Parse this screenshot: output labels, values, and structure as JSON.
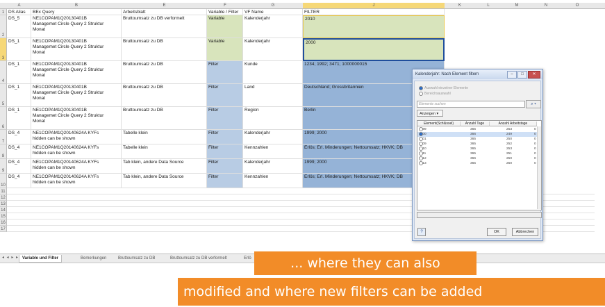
{
  "columns": [
    "A",
    "B",
    "E",
    "F",
    "G",
    "J",
    "K",
    "L",
    "M",
    "N",
    "O"
  ],
  "header_row": {
    "row_number": "1",
    "ds_alias": "DS Alias",
    "bex_query": "BEx Query",
    "arbeitsblatt": "Arbeitsblatt",
    "variable_filter": "Variable / Filter",
    "vf_name": "VF Name",
    "filter": "FILTER"
  },
  "rows": [
    {
      "num": "2",
      "ds": "DS_5",
      "query": "NE1COPAM1Q20130401B\nManagemet Circle Query 2 Struktur\nMonat",
      "sheet": "Bruttoumsatz zu DB verformelt",
      "type": "Variable",
      "name": "Kalenderjahr",
      "filter": "2010"
    },
    {
      "num": "3",
      "ds": "DS_1",
      "query": "NE1COPAM1Q20130401B\nManagemet Circle Query 2 Struktur\nMonat",
      "sheet": "Bruttoumsatz zu DB",
      "type": "Variable",
      "name": "Kalenderjahr",
      "filter": "2000"
    },
    {
      "num": "4",
      "ds": "DS_1",
      "query": "NE1COPAM1Q20130401B\nManagemet Circle Query 2 Struktur\nMonat",
      "sheet": "Bruttoumsatz zu DB",
      "type": "Filter",
      "name": "Kunde",
      "filter": "1234; 1992; 3471; 1000000015"
    },
    {
      "num": "5",
      "ds": "DS_1",
      "query": "NE1COPAM1Q20130401B\nManagemet Circle Query 2 Struktur\nMonat",
      "sheet": "Bruttoumsatz zu DB",
      "type": "Filter",
      "name": "Land",
      "filter": "Deutschland; Grossbritannien"
    },
    {
      "num": "6",
      "ds": "DS_1",
      "query": "NE1COPAM1Q20130401B\nManagemet Circle Query 2 Struktur\nMonat",
      "sheet": "Bruttoumsatz zu DB",
      "type": "Filter",
      "name": "Region",
      "filter": "Berlin"
    },
    {
      "num": "7",
      "ds": "DS_4",
      "query": "NE1COPAM1Q20140624A KYFs\nhidden can be shown",
      "sheet": "Tabelle klein",
      "type": "Filter",
      "name": "Kalenderjahr",
      "filter": "1999; 2000"
    },
    {
      "num": "8",
      "ds": "DS_4",
      "query": "NE1COPAM1Q20140624A KYFs\nhidden can be shown",
      "sheet": "Tabelle klein",
      "type": "Filter",
      "name": "Kennzahlen",
      "filter": "Erlös; Erl. Minderungen; Nettoumsatz; HKVK; DB"
    },
    {
      "num": "9",
      "ds": "DS_4",
      "query": "NE1COPAM1Q20140624A KYFs\nhidden can be shown",
      "sheet": "Tab klein, andere Data Source",
      "type": "Filter",
      "name": "Kalenderjahr",
      "filter": "1999; 2000"
    },
    {
      "num": "10",
      "ds": "DS_4",
      "query": "NE1COPAM1Q20140624A KYFs\nhidden can be shown",
      "sheet": "Tab klein, andere Data Source",
      "type": "Filter",
      "name": "Kennzahlen",
      "filter": "Erlös; Erl. Minderungen; Nettoumsatz; HKVK; DB"
    }
  ],
  "empty_rows": [
    "11",
    "12",
    "13",
    "14",
    "15",
    "16",
    "17"
  ],
  "tabs": [
    "Variable und Filter",
    "Bemerkungen",
    "Bruttoumsatz zu DB",
    "Bruttoumsatz zu DB verformelt",
    "Erlö"
  ],
  "nav_arrows": "◂ ◂ ▸ ▸",
  "dialog": {
    "title": "Kalenderjahr: Nach Element filtern",
    "option1": "Auswahl einzelner Elemente",
    "option2": "Bereichsauswahl",
    "search_placeholder": "Elemente suchen",
    "search_btn": "⌕ ▾",
    "show_btn": "Anzeigen ▾",
    "col_key": "Element(Schlüssel)",
    "col_days": "Anzahl Tage",
    "col_workdays": "Anzahl Arbeitstage",
    "items": [
      {
        "key": "1999",
        "days": "365",
        "work": "253",
        "extra": "0"
      },
      {
        "key": "2000",
        "days": "366",
        "work": "249",
        "extra": "0"
      },
      {
        "key": "2001",
        "days": "365",
        "work": "250",
        "extra": "0"
      },
      {
        "key": "2009",
        "days": "365",
        "work": "252",
        "extra": "0"
      },
      {
        "key": "2010",
        "days": "365",
        "work": "253",
        "extra": "0"
      },
      {
        "key": "2011",
        "days": "365",
        "work": "251",
        "extra": "0"
      },
      {
        "key": "2012",
        "days": "366",
        "work": "250",
        "extra": "0"
      },
      {
        "key": "2013",
        "days": "365",
        "work": "250",
        "extra": "0"
      }
    ],
    "selected_item": "2000",
    "ok": "OK",
    "cancel": "Abbrechen",
    "help": "?"
  },
  "banner1": "... where they can also",
  "banner2": "modified and where new filters can be added",
  "colors": {
    "accent": "#f28c28",
    "green": "#d8e4bc",
    "blue": "#b8cce4",
    "selection": "#1f4e9c"
  }
}
